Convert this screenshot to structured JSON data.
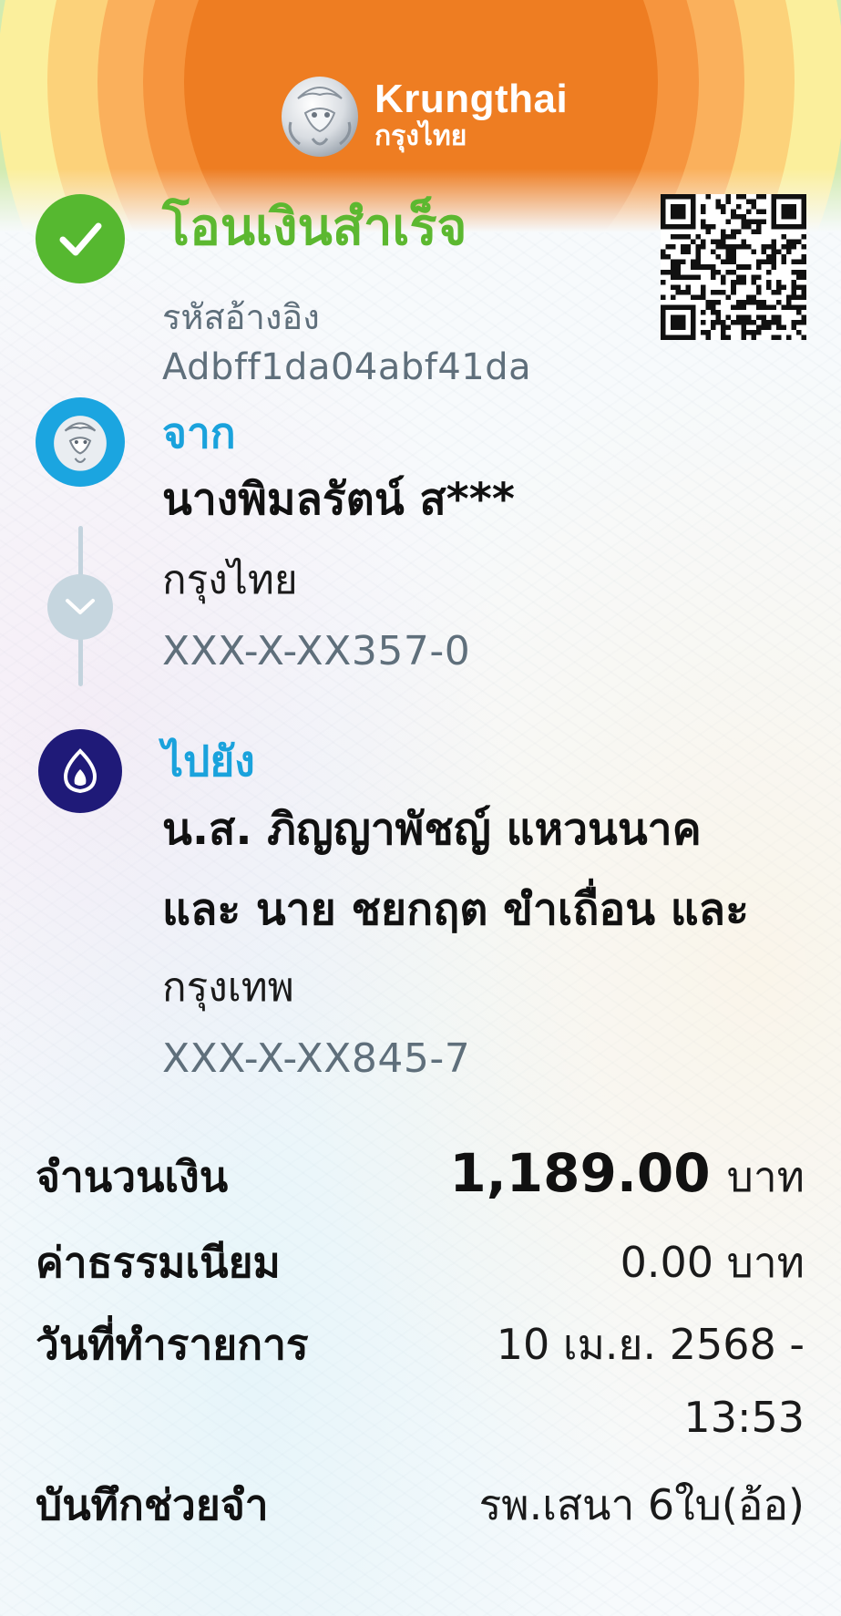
{
  "brand": {
    "name_en": "Krungthai",
    "name_th": "กรุงไทย"
  },
  "status": {
    "title": "โอนเงินสำเร็จ",
    "ref_label": "รหัสอ้างอิง",
    "ref_value": "Adbff1da04abf41da"
  },
  "from": {
    "label": "จาก",
    "name": "นางพิมลรัตน์ ส***",
    "bank": "กรุงไทย",
    "account": "XXX-X-XX357-0"
  },
  "to": {
    "label": "ไปยัง",
    "name_line1": "น.ส. ภิญญาพัชญ์ แหวนนาค",
    "name_line2": "และ นาย ชยกฤต ขำเถื่อน และ",
    "bank": "กรุงเทพ",
    "account": "XXX-X-XX845-7"
  },
  "details": {
    "amount_label": "จำนวนเงิน",
    "amount_value": "1,189.00",
    "amount_unit": "บาท",
    "fee_label": "ค่าธรรมเนียม",
    "fee_value": "0.00 บาท",
    "date_label": "วันที่ทำรายการ",
    "date_value_line1": "10 เม.ย. 2568 -",
    "date_value_line2": "13:53",
    "memo_label": "บันทึกช่วยจำ",
    "memo_value": "รพ.เสนา 6ใบ(อ้อ)"
  },
  "colors": {
    "success_green": "#5cb830",
    "krungthai_blue": "#1aa2dc",
    "bangkok_bank_navy": "#1f1a78",
    "muted_text": "#5f6f7b"
  },
  "icons": {
    "status": "check-icon",
    "from_bank": "krungthai-logo-icon",
    "connector": "chevron-down-icon",
    "to_bank": "bangkok-bank-logo-icon",
    "qr": "qr-code-icon"
  }
}
